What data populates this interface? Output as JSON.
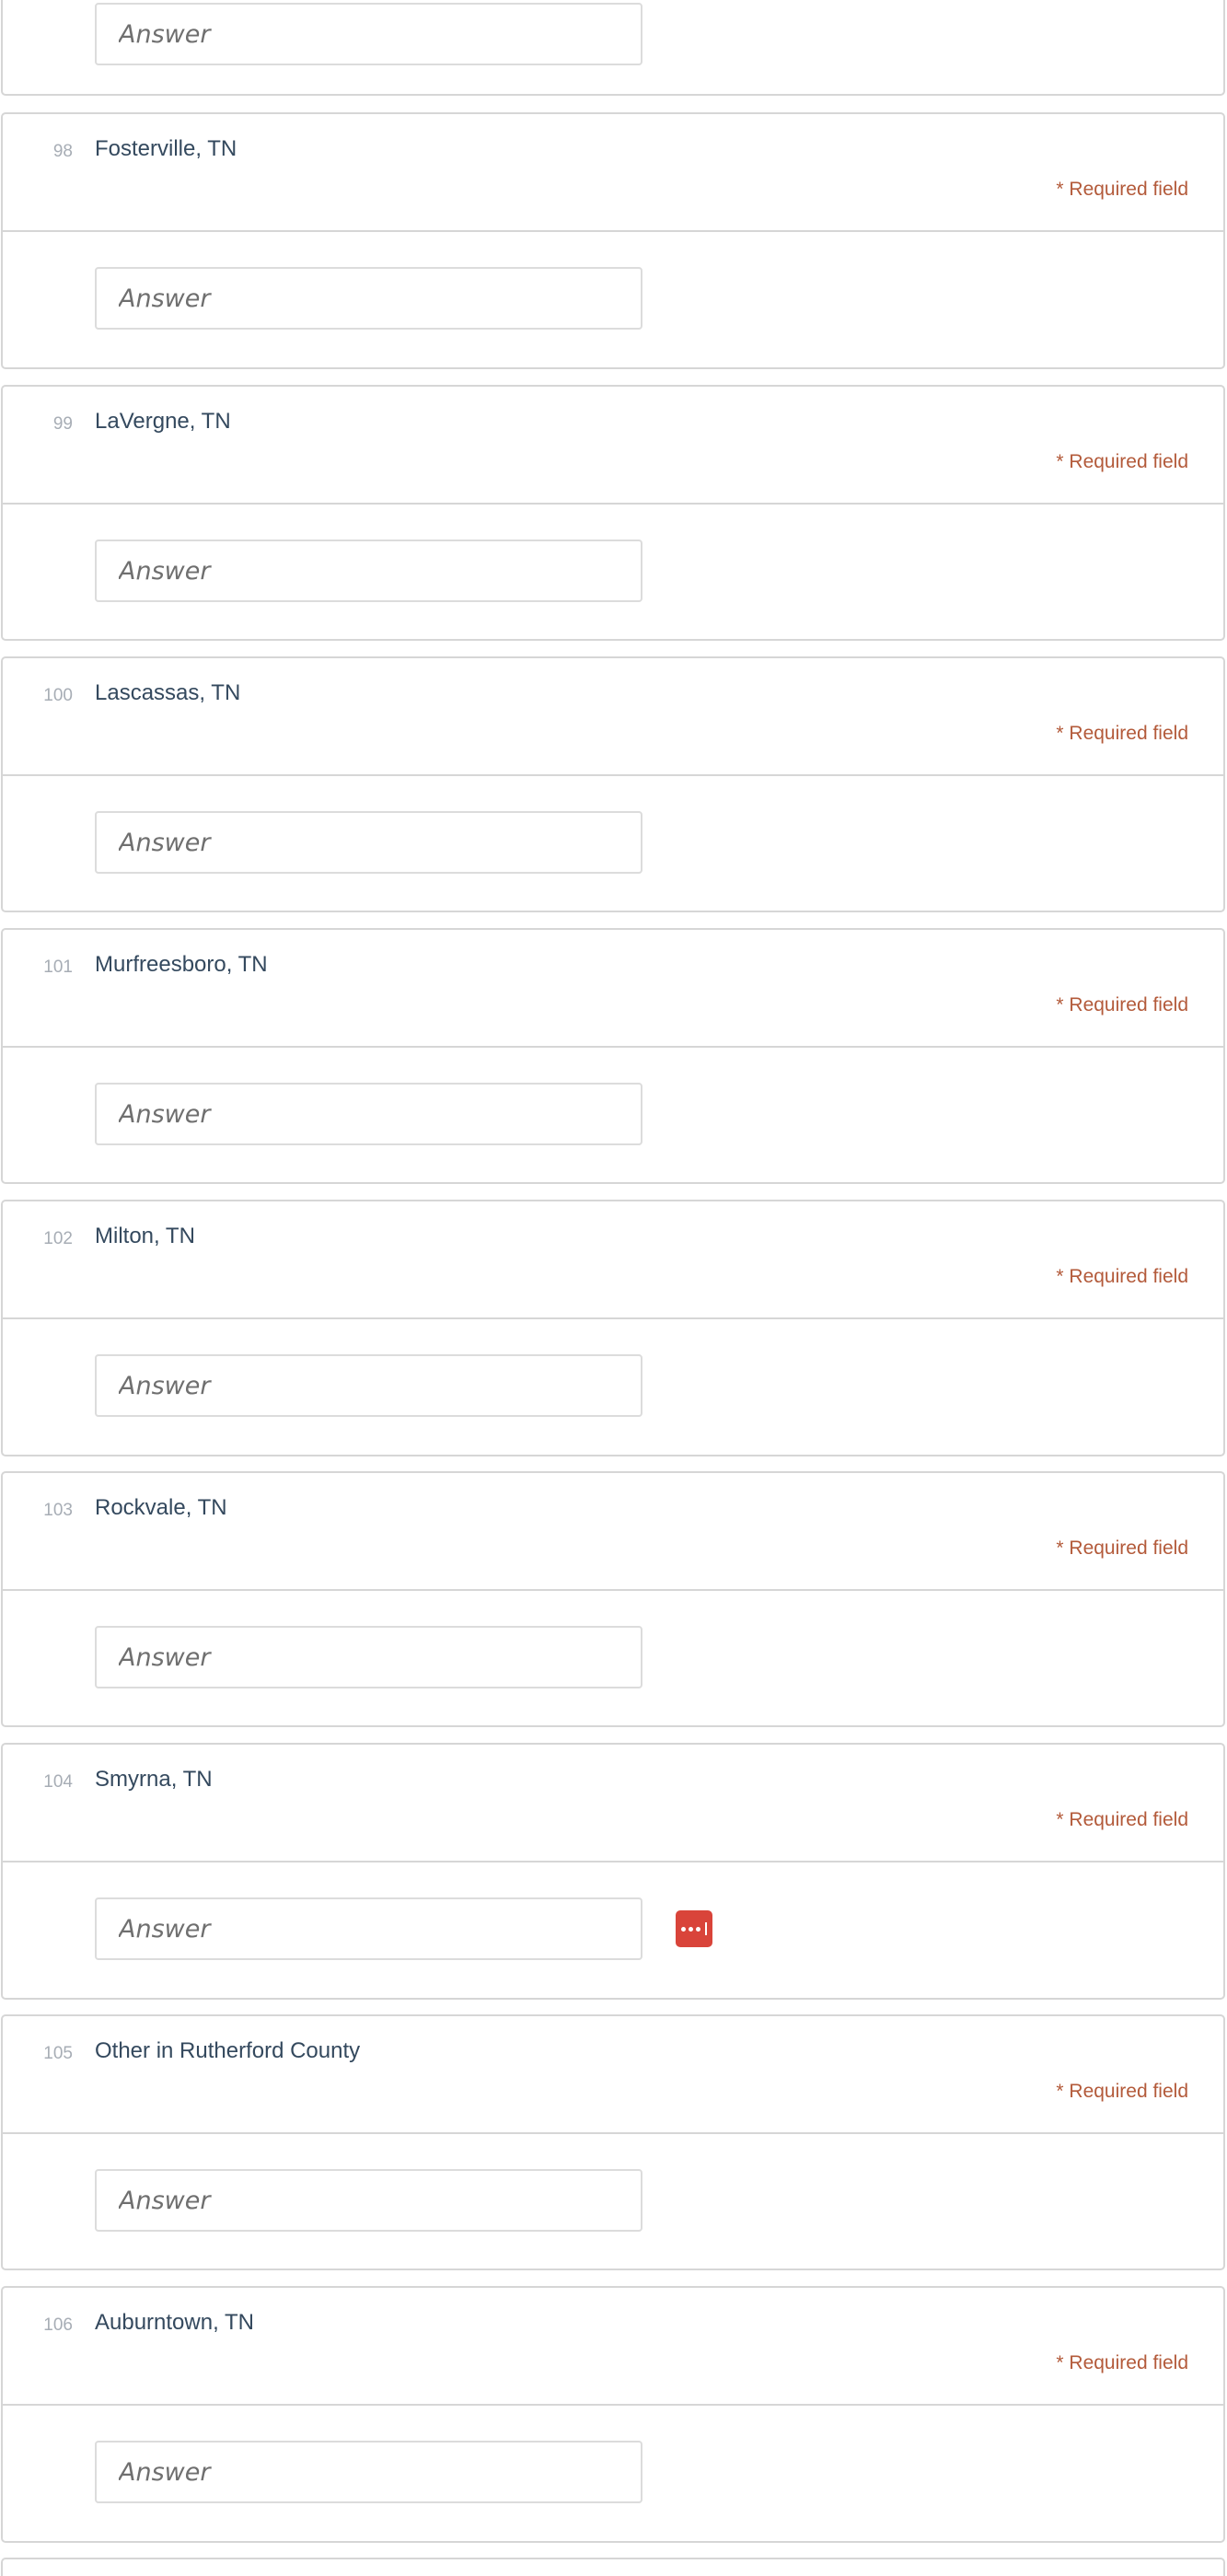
{
  "top_partial": {
    "placeholder": "Answer"
  },
  "questions": [
    {
      "number": "98",
      "title": "Fosterville, TN",
      "required": "* Required field",
      "placeholder": "Answer"
    },
    {
      "number": "99",
      "title": "LaVergne, TN",
      "required": "* Required field",
      "placeholder": "Answer"
    },
    {
      "number": "100",
      "title": "Lascassas, TN",
      "required": "* Required field",
      "placeholder": "Answer"
    },
    {
      "number": "101",
      "title": "Murfreesboro, TN",
      "required": "* Required field",
      "placeholder": "Answer"
    },
    {
      "number": "102",
      "title": "Milton, TN",
      "required": "* Required field",
      "placeholder": "Answer"
    },
    {
      "number": "103",
      "title": "Rockvale, TN",
      "required": "* Required field",
      "placeholder": "Answer"
    },
    {
      "number": "104",
      "title": "Smyrna, TN",
      "required": "* Required field",
      "placeholder": "Answer",
      "extension_icon": "password-manager-icon"
    },
    {
      "number": "105",
      "title": "Other in Rutherford County",
      "required": "* Required field",
      "placeholder": "Answer"
    },
    {
      "number": "106",
      "title": "Auburntown, TN",
      "required": "* Required field",
      "placeholder": "Answer"
    }
  ],
  "colors": {
    "title": "#34495e",
    "number": "#a7adb5",
    "required": "#b35a3a",
    "border": "#d6d6d6",
    "extension_icon_bg": "#d9443a"
  }
}
